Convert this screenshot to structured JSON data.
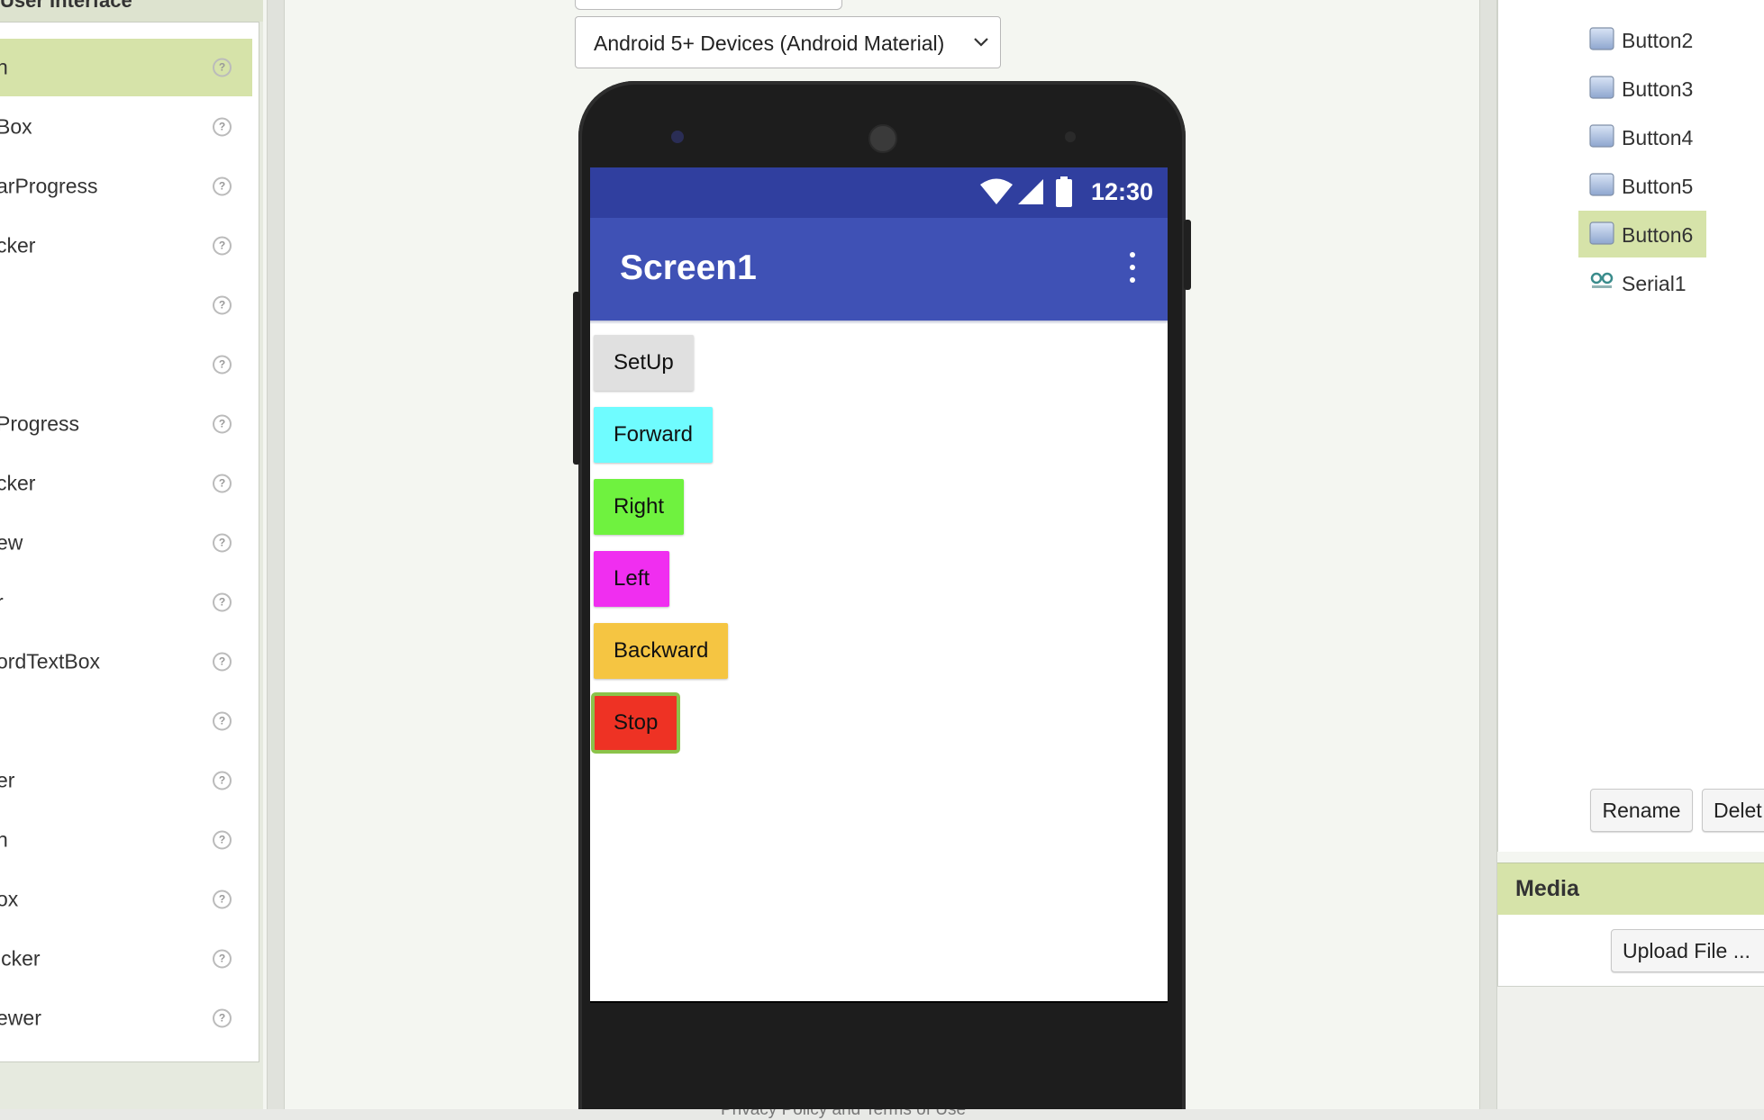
{
  "palette": {
    "header_label": "User Interface",
    "items": [
      {
        "label": "n",
        "selected": true
      },
      {
        "label": "Box"
      },
      {
        "label": "arProgress"
      },
      {
        "label": "cker"
      },
      {
        "label": ""
      },
      {
        "label": ""
      },
      {
        "label": "Progress"
      },
      {
        "label": "cker"
      },
      {
        "label": "ew"
      },
      {
        "label": "r"
      },
      {
        "label": "ordTextBox"
      },
      {
        "label": ""
      },
      {
        "label": "er"
      },
      {
        "label": "n"
      },
      {
        "label": "ox"
      },
      {
        "label": "icker"
      },
      {
        "label": "ewer"
      }
    ],
    "help_glyph": "?"
  },
  "viewer": {
    "device_select": "Android 5+ Devices (Android Material)",
    "status_time": "12:30",
    "screen_title": "Screen1",
    "buttons": [
      {
        "label": "SetUp",
        "color": "#e0e0e0"
      },
      {
        "label": "Forward",
        "color": "#6ffcff"
      },
      {
        "label": "Right",
        "color": "#6ff23f"
      },
      {
        "label": "Left",
        "color": "#f02ef0"
      },
      {
        "label": "Backward",
        "color": "#f5c542"
      },
      {
        "label": "Stop",
        "color": "#ee3224",
        "selected": true
      }
    ]
  },
  "components": {
    "items": [
      {
        "label": "Button2",
        "icon": "button-icon"
      },
      {
        "label": "Button3",
        "icon": "button-icon"
      },
      {
        "label": "Button4",
        "icon": "button-icon"
      },
      {
        "label": "Button5",
        "icon": "button-icon"
      },
      {
        "label": "Button6",
        "icon": "button-icon",
        "selected": true
      },
      {
        "label": "Serial1",
        "icon": "serial-icon"
      }
    ],
    "rename_label": "Rename",
    "delete_label": "Delet"
  },
  "media": {
    "title": "Media",
    "upload_label": "Upload File ..."
  },
  "footer": {
    "text": "Privacy Policy and Terms of Use"
  },
  "colors": {
    "app_bar": "#3f51b5",
    "status_bar": "#303f9f",
    "selection": "#d6e3a9"
  }
}
